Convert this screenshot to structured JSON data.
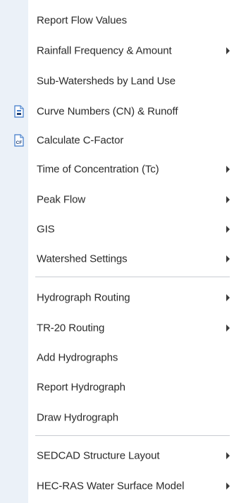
{
  "menu": {
    "items": [
      {
        "label": "Report Flow Values"
      },
      {
        "label": "Rainfall Frequency & Amount"
      },
      {
        "label": "Sub-Watersheds by Land Use"
      },
      {
        "label": "Curve Numbers (CN) & Runoff",
        "icon": "cn-document-icon"
      },
      {
        "label": "Calculate C-Factor",
        "icon": "cf-document-icon"
      },
      {
        "label": "Time of Concentration (Tc)"
      },
      {
        "label": "Peak Flow"
      },
      {
        "label": "GIS"
      },
      {
        "label": "Watershed Settings"
      },
      {
        "label": "Hydrograph Routing"
      },
      {
        "label": "TR-20 Routing"
      },
      {
        "label": "Add Hydrographs"
      },
      {
        "label": "Report Hydrograph"
      },
      {
        "label": "Draw Hydrograph"
      },
      {
        "label": "SEDCAD Structure Layout"
      },
      {
        "label": "HEC-RAS Water Surface Model"
      }
    ],
    "icon_text": {
      "cf": "CF"
    }
  },
  "colors": {
    "gutter": "#ebf1f8",
    "text": "#2b2b2b",
    "separator": "#c8ccd2",
    "icon_blue": "#3c78c8"
  }
}
